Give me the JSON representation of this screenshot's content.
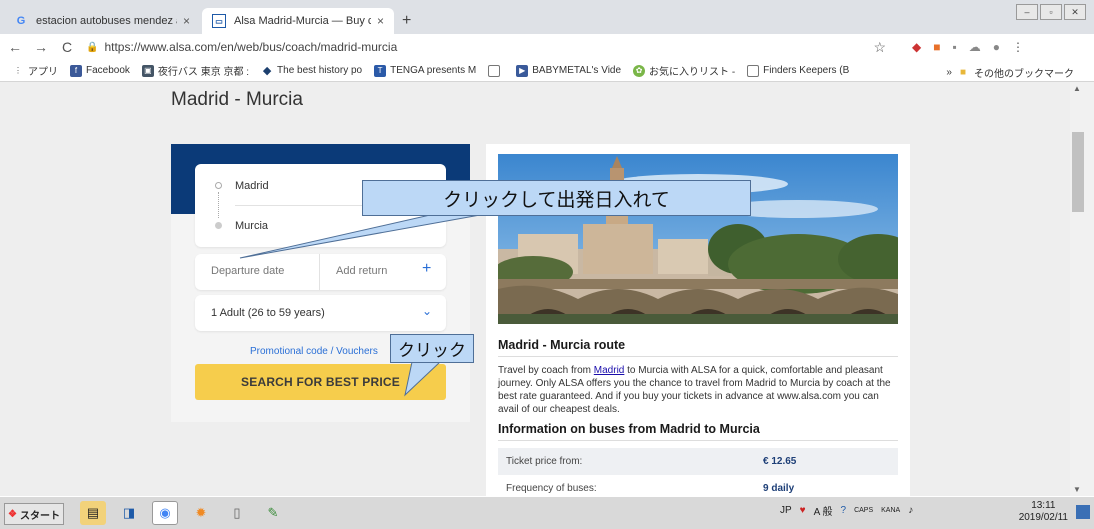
{
  "browser": {
    "tabs": [
      {
        "title": "estacion autobuses mendez al",
        "favicon": "google-icon",
        "active": false
      },
      {
        "title": "Alsa Madrid-Murcia — Buy ch",
        "favicon": "alsa-icon",
        "active": true
      }
    ],
    "new_tab": "+",
    "url": "https://www.alsa.com/en/web/bus/coach/madrid-murcia",
    "bookmarks": [
      {
        "label": "アプリ",
        "icon": "apps-icon"
      },
      {
        "label": "Facebook",
        "icon": "facebook-icon"
      },
      {
        "label": "夜行バス 東京 京都 :",
        "icon": "bus-icon"
      },
      {
        "label": "The best history po",
        "icon": "diamond-icon"
      },
      {
        "label": "TENGA presents M",
        "icon": "tenga-icon"
      },
      {
        "label": "",
        "icon": "page-icon"
      },
      {
        "label": "BABYMETAL's Vide",
        "icon": "video-icon"
      },
      {
        "label": "お気に入りリスト -",
        "icon": "leaf-icon"
      },
      {
        "label": "Finders Keepers (B",
        "icon": "page-icon"
      }
    ],
    "bookmarks_overflow": "»",
    "other_bookmarks": "その他のブックマーク"
  },
  "page": {
    "title": "Madrid - Murcia",
    "search": {
      "origin": "Madrid",
      "destination": "Murcia",
      "departure_placeholder": "Departure date",
      "return_placeholder": "Add return",
      "passengers": "1 Adult (26 to 59 years)",
      "promo_link": "Promotional code / Vouchers",
      "search_button": "SEARCH FOR BEST PRICE"
    },
    "info": {
      "route_title": "Madrid - Murcia route",
      "description_pre": "Travel by coach from ",
      "description_link": "Madrid",
      "description_post": " to Murcia with ALSA for a quick, comfortable and pleasant journey. Only ALSA offers you the chance to travel from Madrid to Murcia by coach at the best rate guaranteed. And if you buy your tickets in advance at www.alsa.com you can avail of our cheapest deals.",
      "buses_title": "Information on buses from Madrid to Murcia",
      "rows": [
        {
          "label": "Ticket price from:",
          "value": "€ 12.65"
        },
        {
          "label": "Frequency of buses:",
          "value": "9 daily"
        }
      ]
    }
  },
  "annotations": {
    "callout_date": "クリックして出発日入れて",
    "callout_search": "クリック"
  },
  "taskbar": {
    "start": "スタート",
    "ime_lang": "JP",
    "ime_mode": "A 般",
    "caps": "CAPS",
    "kana": "KANA",
    "time": "13:11",
    "date": "2019/02/11"
  }
}
